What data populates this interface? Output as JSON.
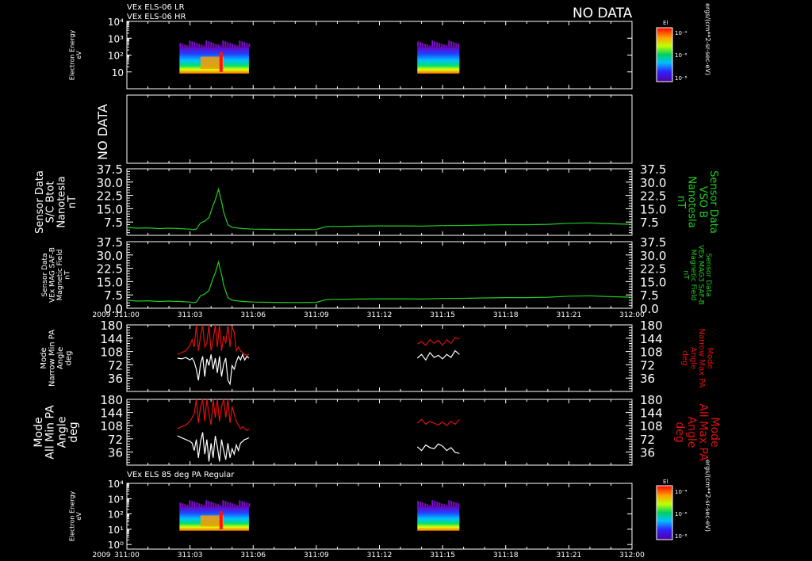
{
  "header": {
    "line1": "VEx ELS-06 LR",
    "line2": "VEx ELS-06 HR",
    "no_data": "NO DATA"
  },
  "colors": {
    "bg": "#000000",
    "frame": "#ffffff",
    "green": "#22cc22",
    "red": "#dd1111",
    "white": "#ffffff"
  },
  "time_axis": {
    "year": "2009",
    "ticks": [
      "311:00",
      "311:03",
      "311:06",
      "311:09",
      "311:12",
      "311:15",
      "311:18",
      "311:21",
      "312:00"
    ]
  },
  "colorbar": {
    "title": "El",
    "units": "ergs/(cm**2-sr-sec-eV)",
    "ticks": [
      "10⁻⁴",
      "10⁻⁶",
      "10⁻⁸"
    ]
  },
  "panels": {
    "p1": {
      "ylabel": [
        "Electron Energy",
        "eV"
      ]
    },
    "p2": {
      "no_data": "NO DATA"
    },
    "p3": {
      "ylabel_left": [
        "Sensor Data",
        "S/C Btot",
        "Nanotesla",
        "nT"
      ],
      "ylabel_right": [
        "Sensor Data",
        "VSO B",
        "Nanotesla",
        "nT"
      ]
    },
    "p4": {
      "ylabel_left": [
        "Sensor Data",
        "VEx MAG SAF-B",
        "Magnetic Field",
        "nT"
      ],
      "ylabel_right": [
        "Sensor Data",
        "VEx MAG3 SAF-B",
        "Magnetic Field",
        "nT"
      ]
    },
    "p5": {
      "ylabel_left": [
        "Mode",
        "Narrow Min PA",
        "Angle",
        "deg"
      ],
      "ylabel_right": [
        "Mode",
        "Narrow Max PA",
        "Angle",
        "deg"
      ]
    },
    "p6": {
      "ylabel_left": [
        "Mode",
        "All Min PA",
        "Angle",
        "deg"
      ],
      "ylabel_right": [
        "Mode",
        "All Max PA",
        "Angle",
        "deg"
      ]
    },
    "p7": {
      "title": "VEx ELS 85 deg PA Regular",
      "ylabel": [
        "Electron Energy",
        "eV"
      ]
    }
  },
  "chart_data": [
    {
      "type": "heatmap",
      "title": "VEx ELS-06 LR / VEx ELS-06 HR",
      "ylabel": "Electron Energy eV",
      "yscale": "log",
      "ylim": [
        1,
        10000
      ],
      "yticks": [
        "10",
        "10²",
        "10³",
        "10⁴"
      ],
      "xlim": [
        0,
        24
      ],
      "data_intervals": [
        [
          2.5,
          5.8
        ],
        [
          13.8,
          15.8
        ]
      ],
      "colorbar_label": "El",
      "colorbar_units": "ergs/(cm**2-sr-sec-eV)"
    },
    {
      "type": "line",
      "no_data": true
    },
    {
      "type": "line",
      "ylabel": "S/C Btot Nanotesla nT",
      "ylim": [
        0,
        37.5
      ],
      "yticks": [
        "7.5",
        "15.0",
        "22.5",
        "30.0",
        "37.5"
      ],
      "xlim": [
        0,
        24
      ],
      "series": [
        {
          "color": "#22cc22",
          "x": [
            0,
            0.5,
            1,
            1.5,
            2,
            2.5,
            3,
            3.1,
            3.3,
            3.5,
            3.7,
            3.9,
            4.1,
            4.2,
            4.35,
            4.5,
            4.6,
            4.8,
            5,
            5.5,
            6,
            7,
            8,
            9,
            9.5,
            10,
            11,
            12,
            13,
            14,
            15,
            16,
            17,
            18,
            19,
            20,
            21,
            22,
            23,
            24
          ],
          "y": [
            4.5,
            4,
            4.2,
            3.8,
            4,
            3.8,
            3.5,
            3.2,
            3.5,
            7,
            8,
            10,
            17,
            20,
            26,
            19,
            13,
            6,
            4.5,
            3.8,
            3.5,
            3.3,
            3.2,
            3.3,
            5,
            5,
            5.2,
            5.3,
            5.3,
            5.2,
            5.5,
            5.6,
            5.8,
            6,
            6,
            6.2,
            6.8,
            7,
            6.5,
            6.2
          ]
        }
      ]
    },
    {
      "type": "line",
      "ylabel": "VEx MAG SAF-B Magnetic Field nT",
      "ylim": [
        0,
        37.5
      ],
      "yticks": [
        "0.0",
        "7.5",
        "15.0",
        "22.5",
        "30.0",
        "37.5"
      ],
      "xlim": [
        0,
        24
      ],
      "series": [
        {
          "color": "#22cc22",
          "x": [
            0,
            0.5,
            1,
            1.5,
            2,
            2.5,
            3,
            3.1,
            3.3,
            3.5,
            3.7,
            3.9,
            4.1,
            4.2,
            4.35,
            4.5,
            4.6,
            4.8,
            5,
            5.5,
            6,
            7,
            8,
            9,
            9.5,
            10,
            11,
            12,
            13,
            14,
            15,
            16,
            17,
            18,
            19,
            20,
            21,
            22,
            23,
            24
          ],
          "y": [
            4.5,
            4,
            4.2,
            3.8,
            4,
            3.8,
            3.5,
            3.2,
            3.5,
            7,
            8,
            10,
            17,
            20,
            26,
            19,
            13,
            6,
            4.5,
            3.8,
            3.5,
            3.3,
            3.2,
            3.3,
            5,
            5,
            5.2,
            5.3,
            5.3,
            5.2,
            5.5,
            5.6,
            5.8,
            6,
            6,
            6.2,
            6.8,
            7,
            6.5,
            6.2
          ]
        }
      ]
    },
    {
      "type": "line",
      "ylabel": "Narrow Min/Max PA Angle deg",
      "ylim": [
        0,
        180
      ],
      "yticks": [
        "36",
        "72",
        "108",
        "144",
        "180"
      ],
      "xlim": [
        0,
        24
      ],
      "series": [
        {
          "name": "Narrow Min PA",
          "color": "#ffffff",
          "segments": [
            {
              "x": [
                2.4,
                2.6,
                2.8,
                3,
                3.1,
                3.2,
                3.3,
                3.4,
                3.5,
                3.6,
                3.7,
                3.8,
                3.9,
                4,
                4.1,
                4.2,
                4.3,
                4.4,
                4.5,
                4.6,
                4.7,
                4.8,
                4.9,
                5,
                5.1,
                5.2,
                5.3,
                5.4,
                5.5,
                5.6,
                5.7,
                5.8
              ],
              "y": [
                90,
                88,
                92,
                85,
                90,
                80,
                60,
                30,
                75,
                95,
                40,
                88,
                70,
                100,
                60,
                90,
                50,
                95,
                40,
                75,
                90,
                30,
                20,
                70,
                60,
                80,
                95,
                85,
                100,
                85,
                95,
                90
              ]
            },
            {
              "x": [
                13.8,
                14,
                14.2,
                14.4,
                14.6,
                14.8,
                15,
                15.2,
                15.4,
                15.6,
                15.8
              ],
              "y": [
                90,
                100,
                85,
                105,
                92,
                98,
                88,
                100,
                92,
                110,
                100
              ]
            }
          ]
        },
        {
          "name": "Narrow Max PA",
          "color": "#dd1111",
          "segments": [
            {
              "x": [
                2.4,
                2.6,
                2.8,
                3,
                3.1,
                3.2,
                3.3,
                3.4,
                3.5,
                3.6,
                3.7,
                3.8,
                3.9,
                4,
                4.1,
                4.2,
                4.3,
                4.4,
                4.5,
                4.6,
                4.7,
                4.8,
                4.9,
                5,
                5.1,
                5.2,
                5.3,
                5.4,
                5.5,
                5.6,
                5.7,
                5.8
              ],
              "y": [
                100,
                105,
                110,
                125,
                140,
                120,
                180,
                110,
                150,
                180,
                120,
                130,
                180,
                110,
                140,
                180,
                120,
                180,
                110,
                150,
                130,
                180,
                120,
                175,
                160,
                110,
                120,
                110,
                105,
                100,
                98,
                100
              ]
            },
            {
              "x": [
                13.8,
                14,
                14.2,
                14.4,
                14.6,
                14.8,
                15,
                15.2,
                15.4,
                15.6,
                15.8
              ],
              "y": [
                128,
                135,
                125,
                140,
                130,
                138,
                125,
                140,
                130,
                145,
                142
              ]
            }
          ]
        }
      ]
    },
    {
      "type": "line",
      "ylabel": "All Min/Max PA Angle deg",
      "ylim": [
        0,
        180
      ],
      "yticks": [
        "36",
        "72",
        "108",
        "144",
        "180"
      ],
      "xlim": [
        0,
        24
      ],
      "series": [
        {
          "name": "All Min PA",
          "color": "#ffffff",
          "segments": [
            {
              "x": [
                2.4,
                2.6,
                2.8,
                3,
                3.1,
                3.2,
                3.3,
                3.4,
                3.5,
                3.6,
                3.7,
                3.8,
                3.9,
                4,
                4.1,
                4.2,
                4.3,
                4.4,
                4.5,
                4.6,
                4.7,
                4.8,
                4.9,
                5,
                5.1,
                5.2,
                5.3,
                5.4,
                5.5,
                5.6,
                5.7,
                5.8
              ],
              "y": [
                80,
                75,
                70,
                65,
                60,
                40,
                70,
                20,
                65,
                90,
                30,
                70,
                10,
                60,
                20,
                80,
                50,
                10,
                70,
                40,
                15,
                60,
                20,
                45,
                30,
                55,
                40,
                60,
                65,
                70,
                72,
                75
              ]
            },
            {
              "x": [
                13.8,
                14,
                14.2,
                14.4,
                14.6,
                14.8,
                15,
                15.2,
                15.4,
                15.6,
                15.8
              ],
              "y": [
                50,
                40,
                55,
                48,
                45,
                58,
                52,
                40,
                48,
                35,
                32
              ]
            }
          ]
        },
        {
          "name": "All Max PA",
          "color": "#dd1111",
          "segments": [
            {
              "x": [
                2.4,
                2.6,
                2.8,
                3,
                3.1,
                3.2,
                3.3,
                3.4,
                3.5,
                3.6,
                3.7,
                3.8,
                3.9,
                4,
                4.1,
                4.2,
                4.3,
                4.4,
                4.5,
                4.6,
                4.7,
                4.8,
                4.9,
                5,
                5.1,
                5.2,
                5.3,
                5.4,
                5.5,
                5.6,
                5.7,
                5.8
              ],
              "y": [
                100,
                105,
                110,
                120,
                130,
                140,
                180,
                115,
                160,
                180,
                120,
                180,
                140,
                110,
                180,
                130,
                180,
                120,
                160,
                180,
                130,
                180,
                115,
                160,
                140,
                120,
                110,
                100,
                105,
                100,
                95,
                100
              ]
            },
            {
              "x": [
                13.8,
                14,
                14.2,
                14.4,
                14.6,
                14.8,
                15,
                15.2,
                15.4,
                15.6,
                15.8
              ],
              "y": [
                115,
                125,
                112,
                120,
                115,
                110,
                118,
                108,
                120,
                112,
                125
              ]
            }
          ]
        }
      ]
    },
    {
      "type": "heatmap",
      "title": "VEx ELS 85 deg PA Regular",
      "ylabel": "Electron Energy eV",
      "yscale": "log",
      "ylim": [
        0.5,
        10000
      ],
      "yticks": [
        "10⁰",
        "10¹",
        "10²",
        "10³",
        "10⁴"
      ],
      "xlim": [
        0,
        24
      ],
      "data_intervals": [
        [
          2.5,
          5.8
        ],
        [
          13.8,
          15.8
        ]
      ],
      "colorbar_label": "El",
      "colorbar_units": "ergs/(cm**2-sr-sec-eV)"
    }
  ]
}
